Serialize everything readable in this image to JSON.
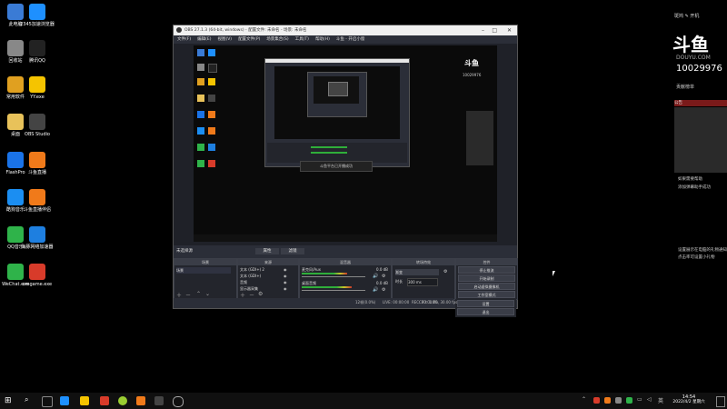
{
  "desktop_icons": [
    {
      "label": "此电脑",
      "color": "#3a7bd5"
    },
    {
      "label": "2345加速浏览器",
      "color": "#1e90ff"
    },
    {
      "label": "回收站",
      "color": "#888888"
    },
    {
      "label": "腾讯QQ",
      "color": "#222222"
    },
    {
      "label": "常用软件",
      "color": "#e0a020"
    },
    {
      "label": "YY.exe",
      "color": "#f5c400"
    },
    {
      "label": "桌面",
      "color": "#e8c25a"
    },
    {
      "label": "OBS Studio",
      "color": "#444444"
    },
    {
      "label": "FlashPro",
      "color": "#1a73e8"
    },
    {
      "label": "斗鱼直播",
      "color": "#f07a1a"
    },
    {
      "label": "酷狗音乐",
      "color": "#1b8ef2"
    },
    {
      "label": "斗鱼直播伴侣",
      "color": "#f07a1a"
    },
    {
      "label": "QQ音乐",
      "color": "#2fb34a"
    },
    {
      "label": "海豚网络加速器",
      "color": "#1e7fe0"
    },
    {
      "label": "WeChat.exe",
      "color": "#2fb34a"
    },
    {
      "label": "cmgame.exe",
      "color": "#d83b2a"
    }
  ],
  "obs": {
    "title": "OBS 27.1.3 (64-bit, windows) - 配置文件: 未命名 - 场景: 未命名",
    "menu": [
      "文件(F)",
      "编辑(E)",
      "视图(V)",
      "配置文件(P)",
      "场景集合(S)",
      "工具(T)",
      "帮助(H)",
      "斗鱼 - 开启小窗"
    ],
    "preview_popup": "斗鱼平台已开播成功",
    "scene_label": "未选择源",
    "props_button": "属性",
    "filters_button": "滤镜",
    "docks": {
      "scenes": {
        "title": "场景",
        "items": [
          "场景"
        ]
      },
      "sources": {
        "title": "来源",
        "items": [
          "文本 (GDI+) 2",
          "文本 (GDI+)",
          "音频",
          "显示器采集"
        ]
      },
      "mixer": {
        "title": "混音器",
        "channels": [
          {
            "name": "麦克风/Aux",
            "level": "0.0 dB",
            "fill": 0.72
          },
          {
            "name": "桌面音频",
            "level": "0.0 dB",
            "fill": 0.78
          }
        ]
      },
      "transitions": {
        "title": "转场特效",
        "type": "渐变",
        "duration_label": "时长",
        "duration_value": "300 ms"
      },
      "controls": {
        "title": "控件",
        "buttons": [
          "停止推流",
          "开始录制",
          "启动虚拟摄像机",
          "工作室模式",
          "设置",
          "退出"
        ]
      }
    },
    "statusbar": {
      "live": "LIVE: 00:00:00",
      "rec": "REC: 00:00:00",
      "cpu": "CPU: 1.0%, 30.00 fps",
      "dropped": "12帧(0.0%)"
    }
  },
  "douyu": {
    "user": "斑鸠 ✎ 开机",
    "logo": "斗鱼",
    "site": "DOUYU.COM",
    "room_id": "10029976",
    "gift_rank_label": "贡献榜单",
    "notice_title": "公告",
    "text1": "如果需要帮助",
    "text2": "添加弹幕助手成功",
    "text3": "设置展示在电脑的礼物通知点击率可设置小礼物"
  },
  "taskbar": {
    "time": "14:54",
    "date": "2022/4/2 星期六",
    "lang": "英"
  }
}
